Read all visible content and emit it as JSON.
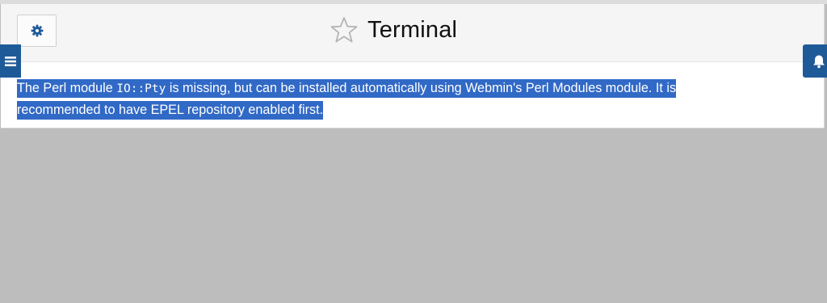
{
  "header": {
    "title": "Terminal",
    "favorite_icon": "star-outline-icon",
    "settings_icon": "gear-icon"
  },
  "sidebar_toggle": {
    "icon": "hamburger-menu-icon"
  },
  "notifications": {
    "icon": "bell-icon"
  },
  "message": {
    "prefix": "The Perl module ",
    "module_name": "IO::Pty",
    "suffix": " is missing, but can be installed automatically using Webmin's Perl Modules module. It is recommended to have EPEL repository enabled first."
  },
  "colors": {
    "accent": "#1f5a98",
    "selection": "#3169c6",
    "background": "#bdbdbd"
  }
}
